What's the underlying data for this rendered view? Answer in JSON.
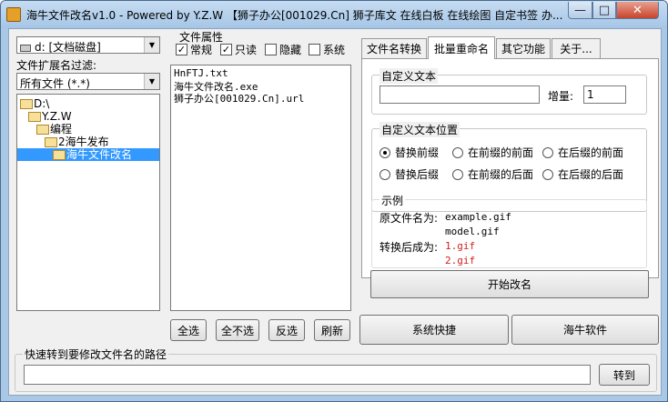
{
  "window": {
    "title": "海牛文件改名v1.0 - Powered by Y.Z.W  【狮子办公[001029.Cn] 狮子库文 在线白板 在线绘图 自定书签 办...",
    "minimize": "—",
    "maximize": "□",
    "close": "✕"
  },
  "left": {
    "drive": "d: [文档磁盘]",
    "filter_label": "文件扩展名过滤:",
    "filter_value": "所有文件 (*.*)",
    "tree": [
      {
        "label": "D:\\"
      },
      {
        "label": "Y.Z.W"
      },
      {
        "label": "编程"
      },
      {
        "label": "2海牛发布"
      },
      {
        "label": "海牛文件改名"
      }
    ]
  },
  "attrs": {
    "caption": "文件属性",
    "normal": "常规",
    "readonly": "只读",
    "hidden": "隐藏",
    "system": "系统",
    "normal_checked": "✓",
    "readonly_checked": "✓",
    "hidden_checked": "",
    "system_checked": ""
  },
  "files": [
    "HnFTJ.txt",
    "海牛文件改名.exe",
    "狮子办公[001029.Cn].url"
  ],
  "file_buttons": {
    "select_all": "全选",
    "select_none": "全不选",
    "invert": "反选",
    "refresh": "刷新"
  },
  "tabs": [
    "文件名转换",
    "批量重命名",
    "其它功能",
    "关于..."
  ],
  "batch": {
    "custom_text_caption": "自定义文本",
    "custom_text_value": "",
    "increment_label": "增量:",
    "increment_value": "1",
    "position_caption": "自定义文本位置",
    "positions": [
      "替换前缀",
      "在前缀的前面",
      "在后缀的前面",
      "替换后缀",
      "在前缀的后面",
      "在后缀的后面"
    ],
    "example_caption": "示例",
    "orig_label": "原文件名为:",
    "orig_files": [
      "example.gif",
      "model.gif"
    ],
    "after_label": "转换后成为:",
    "after_files": [
      "1.gif",
      "2.gif"
    ],
    "start_button": "开始改名"
  },
  "bottom_buttons": {
    "shortcut": "系统快捷",
    "software": "海牛软件"
  },
  "path": {
    "caption": "快速转到要修改文件名的路径",
    "value": "",
    "go": "转到"
  },
  "colors": {
    "accent_selection": "#3399ff",
    "example_result": "#d02020"
  }
}
